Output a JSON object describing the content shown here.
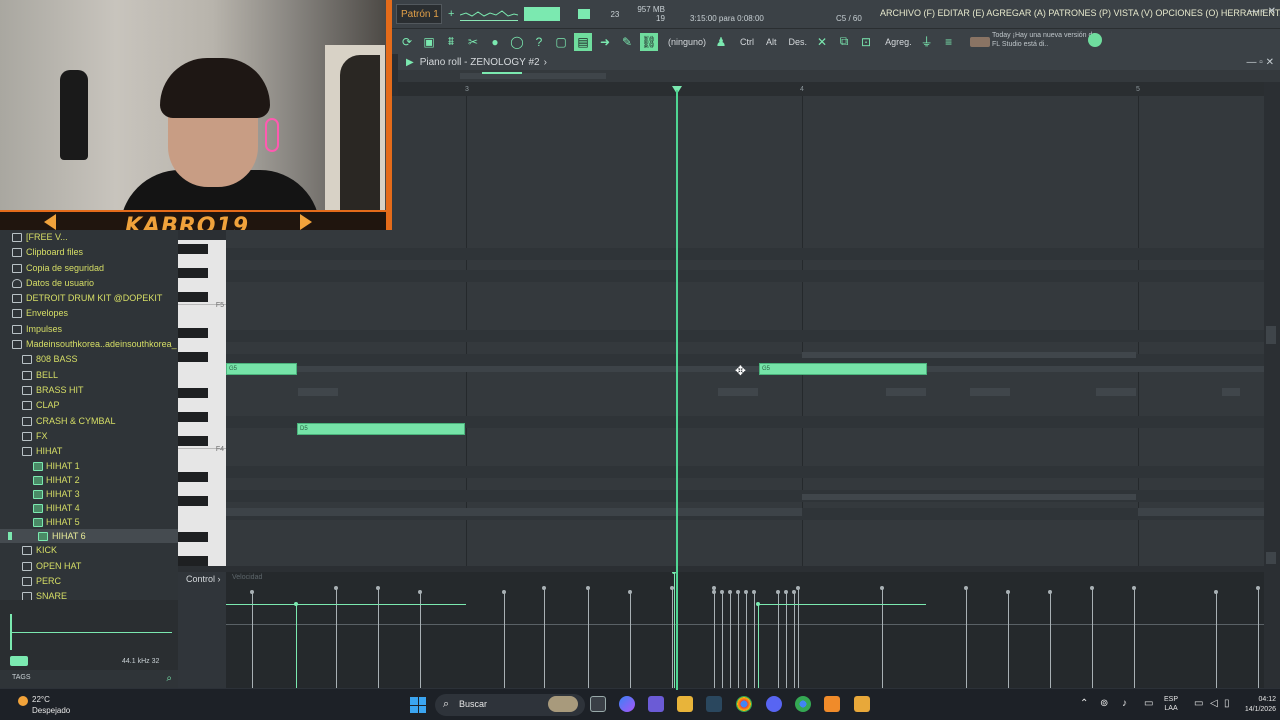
{
  "webcam": {
    "streamer_name": "KABRO19"
  },
  "topbar": {
    "pattern": "Patrón 1",
    "cpu_value": "23",
    "memory": "957 MB",
    "poly": "19",
    "time_remaining": "3:15:00 para 0:08:00",
    "counter": "C5 / 60",
    "menu": "ARCHIVO (F) EDITAR (E) AGREGAR (A) PATRONES (P) VISTA (V) OPCIONES (O) HERRAMIENTAS (T) AYUDA"
  },
  "toolbar": {
    "target_label": "(ninguno)",
    "ctrl_label": "Ctrl",
    "alt_label": "Alt",
    "des_label": "Des.",
    "agreg_label": "Agreg.",
    "news_date": "Today",
    "news_text": "¡Hay una nueva versión de FL Studio está di.."
  },
  "piano_roll": {
    "title": "Piano roll - ZENOLOGY #2",
    "ruler": [
      "3",
      "4",
      "5"
    ],
    "key_labels": [
      "F5",
      "F4"
    ],
    "notes": [
      {
        "label": "G5",
        "start": 0.0,
        "len": 0.21
      },
      {
        "label": "G5",
        "start": 1.59,
        "len": 0.5
      },
      {
        "label": "D5",
        "start": 0.21,
        "len": 0.5
      }
    ]
  },
  "control": {
    "label": "Control",
    "hint": "Velocidad"
  },
  "browser": {
    "items": [
      {
        "label": "[FREE V...",
        "level": 0,
        "icon": "folder-icon"
      },
      {
        "label": "Clipboard files",
        "level": 0,
        "icon": "folder-icon"
      },
      {
        "label": "Copia de seguridad",
        "level": 0,
        "icon": "folder-icon"
      },
      {
        "label": "Datos de usuario",
        "level": 0,
        "icon": "user-icon"
      },
      {
        "label": "DETROIT DRUM KIT @DOPEKIT",
        "level": 0,
        "icon": "folder-icon"
      },
      {
        "label": "Envelopes",
        "level": 0,
        "icon": "folder-icon"
      },
      {
        "label": "Impulses",
        "level": 0,
        "icon": "folder-icon"
      },
      {
        "label": "Madeinsouthkorea..adeinsouthkorea_",
        "level": 0,
        "icon": "folder-open-icon"
      },
      {
        "label": "808 BASS",
        "level": 1,
        "icon": "folder-icon"
      },
      {
        "label": "BELL",
        "level": 1,
        "icon": "folder-icon"
      },
      {
        "label": "BRASS HIT",
        "level": 1,
        "icon": "folder-icon"
      },
      {
        "label": "CLAP",
        "level": 1,
        "icon": "folder-icon"
      },
      {
        "label": "CRASH & CYMBAL",
        "level": 1,
        "icon": "folder-icon"
      },
      {
        "label": "FX",
        "level": 1,
        "icon": "folder-icon"
      },
      {
        "label": "HIHAT",
        "level": 1,
        "icon": "folder-open-icon"
      },
      {
        "label": "HIHAT 1",
        "level": 2,
        "icon": "audio-file-icon"
      },
      {
        "label": "HIHAT 2",
        "level": 2,
        "icon": "audio-file-icon"
      },
      {
        "label": "HIHAT 3",
        "level": 2,
        "icon": "audio-file-icon"
      },
      {
        "label": "HIHAT 4",
        "level": 2,
        "icon": "audio-file-icon"
      },
      {
        "label": "HIHAT 5",
        "level": 2,
        "icon": "audio-file-icon"
      },
      {
        "label": "HIHAT 6",
        "level": 3,
        "icon": "audio-file-icon"
      },
      {
        "label": "KICK",
        "level": 1,
        "icon": "folder-icon"
      },
      {
        "label": "OPEN HAT",
        "level": 1,
        "icon": "folder-icon"
      },
      {
        "label": "PERC",
        "level": 1,
        "icon": "folder-icon"
      },
      {
        "label": "SNARE",
        "level": 1,
        "icon": "folder-icon"
      }
    ],
    "sample_rate": "44.1 kHz 32",
    "tags_label": "TAGS"
  },
  "taskbar": {
    "temperature": "22°C",
    "weather": "Despejado",
    "search_placeholder": "Buscar",
    "lang_1": "ESP",
    "lang_2": "LAA",
    "time": "04:12",
    "date": "14/1/2026"
  },
  "colors": {
    "accent": "#7be9b0",
    "note": "#76e3a8",
    "browser_text": "#d7df66",
    "webcam_frame": "#e46b1a"
  }
}
